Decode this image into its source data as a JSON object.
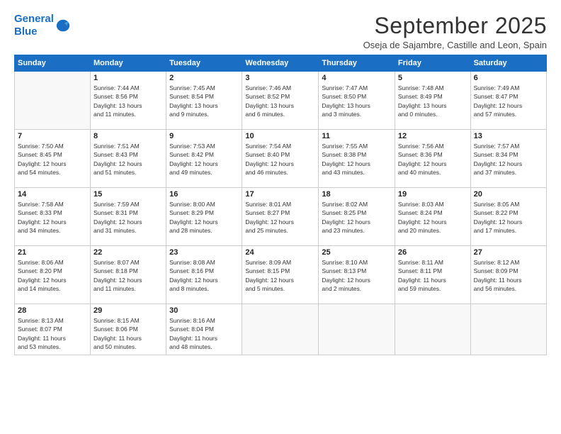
{
  "header": {
    "logo_line1": "General",
    "logo_line2": "Blue",
    "month": "September 2025",
    "location": "Oseja de Sajambre, Castille and Leon, Spain"
  },
  "weekdays": [
    "Sunday",
    "Monday",
    "Tuesday",
    "Wednesday",
    "Thursday",
    "Friday",
    "Saturday"
  ],
  "weeks": [
    [
      {
        "day": "",
        "info": ""
      },
      {
        "day": "1",
        "info": "Sunrise: 7:44 AM\nSunset: 8:56 PM\nDaylight: 13 hours\nand 11 minutes."
      },
      {
        "day": "2",
        "info": "Sunrise: 7:45 AM\nSunset: 8:54 PM\nDaylight: 13 hours\nand 9 minutes."
      },
      {
        "day": "3",
        "info": "Sunrise: 7:46 AM\nSunset: 8:52 PM\nDaylight: 13 hours\nand 6 minutes."
      },
      {
        "day": "4",
        "info": "Sunrise: 7:47 AM\nSunset: 8:50 PM\nDaylight: 13 hours\nand 3 minutes."
      },
      {
        "day": "5",
        "info": "Sunrise: 7:48 AM\nSunset: 8:49 PM\nDaylight: 13 hours\nand 0 minutes."
      },
      {
        "day": "6",
        "info": "Sunrise: 7:49 AM\nSunset: 8:47 PM\nDaylight: 12 hours\nand 57 minutes."
      }
    ],
    [
      {
        "day": "7",
        "info": "Sunrise: 7:50 AM\nSunset: 8:45 PM\nDaylight: 12 hours\nand 54 minutes."
      },
      {
        "day": "8",
        "info": "Sunrise: 7:51 AM\nSunset: 8:43 PM\nDaylight: 12 hours\nand 51 minutes."
      },
      {
        "day": "9",
        "info": "Sunrise: 7:53 AM\nSunset: 8:42 PM\nDaylight: 12 hours\nand 49 minutes."
      },
      {
        "day": "10",
        "info": "Sunrise: 7:54 AM\nSunset: 8:40 PM\nDaylight: 12 hours\nand 46 minutes."
      },
      {
        "day": "11",
        "info": "Sunrise: 7:55 AM\nSunset: 8:38 PM\nDaylight: 12 hours\nand 43 minutes."
      },
      {
        "day": "12",
        "info": "Sunrise: 7:56 AM\nSunset: 8:36 PM\nDaylight: 12 hours\nand 40 minutes."
      },
      {
        "day": "13",
        "info": "Sunrise: 7:57 AM\nSunset: 8:34 PM\nDaylight: 12 hours\nand 37 minutes."
      }
    ],
    [
      {
        "day": "14",
        "info": "Sunrise: 7:58 AM\nSunset: 8:33 PM\nDaylight: 12 hours\nand 34 minutes."
      },
      {
        "day": "15",
        "info": "Sunrise: 7:59 AM\nSunset: 8:31 PM\nDaylight: 12 hours\nand 31 minutes."
      },
      {
        "day": "16",
        "info": "Sunrise: 8:00 AM\nSunset: 8:29 PM\nDaylight: 12 hours\nand 28 minutes."
      },
      {
        "day": "17",
        "info": "Sunrise: 8:01 AM\nSunset: 8:27 PM\nDaylight: 12 hours\nand 25 minutes."
      },
      {
        "day": "18",
        "info": "Sunrise: 8:02 AM\nSunset: 8:25 PM\nDaylight: 12 hours\nand 23 minutes."
      },
      {
        "day": "19",
        "info": "Sunrise: 8:03 AM\nSunset: 8:24 PM\nDaylight: 12 hours\nand 20 minutes."
      },
      {
        "day": "20",
        "info": "Sunrise: 8:05 AM\nSunset: 8:22 PM\nDaylight: 12 hours\nand 17 minutes."
      }
    ],
    [
      {
        "day": "21",
        "info": "Sunrise: 8:06 AM\nSunset: 8:20 PM\nDaylight: 12 hours\nand 14 minutes."
      },
      {
        "day": "22",
        "info": "Sunrise: 8:07 AM\nSunset: 8:18 PM\nDaylight: 12 hours\nand 11 minutes."
      },
      {
        "day": "23",
        "info": "Sunrise: 8:08 AM\nSunset: 8:16 PM\nDaylight: 12 hours\nand 8 minutes."
      },
      {
        "day": "24",
        "info": "Sunrise: 8:09 AM\nSunset: 8:15 PM\nDaylight: 12 hours\nand 5 minutes."
      },
      {
        "day": "25",
        "info": "Sunrise: 8:10 AM\nSunset: 8:13 PM\nDaylight: 12 hours\nand 2 minutes."
      },
      {
        "day": "26",
        "info": "Sunrise: 8:11 AM\nSunset: 8:11 PM\nDaylight: 11 hours\nand 59 minutes."
      },
      {
        "day": "27",
        "info": "Sunrise: 8:12 AM\nSunset: 8:09 PM\nDaylight: 11 hours\nand 56 minutes."
      }
    ],
    [
      {
        "day": "28",
        "info": "Sunrise: 8:13 AM\nSunset: 8:07 PM\nDaylight: 11 hours\nand 53 minutes."
      },
      {
        "day": "29",
        "info": "Sunrise: 8:15 AM\nSunset: 8:06 PM\nDaylight: 11 hours\nand 50 minutes."
      },
      {
        "day": "30",
        "info": "Sunrise: 8:16 AM\nSunset: 8:04 PM\nDaylight: 11 hours\nand 48 minutes."
      },
      {
        "day": "",
        "info": ""
      },
      {
        "day": "",
        "info": ""
      },
      {
        "day": "",
        "info": ""
      },
      {
        "day": "",
        "info": ""
      }
    ]
  ]
}
